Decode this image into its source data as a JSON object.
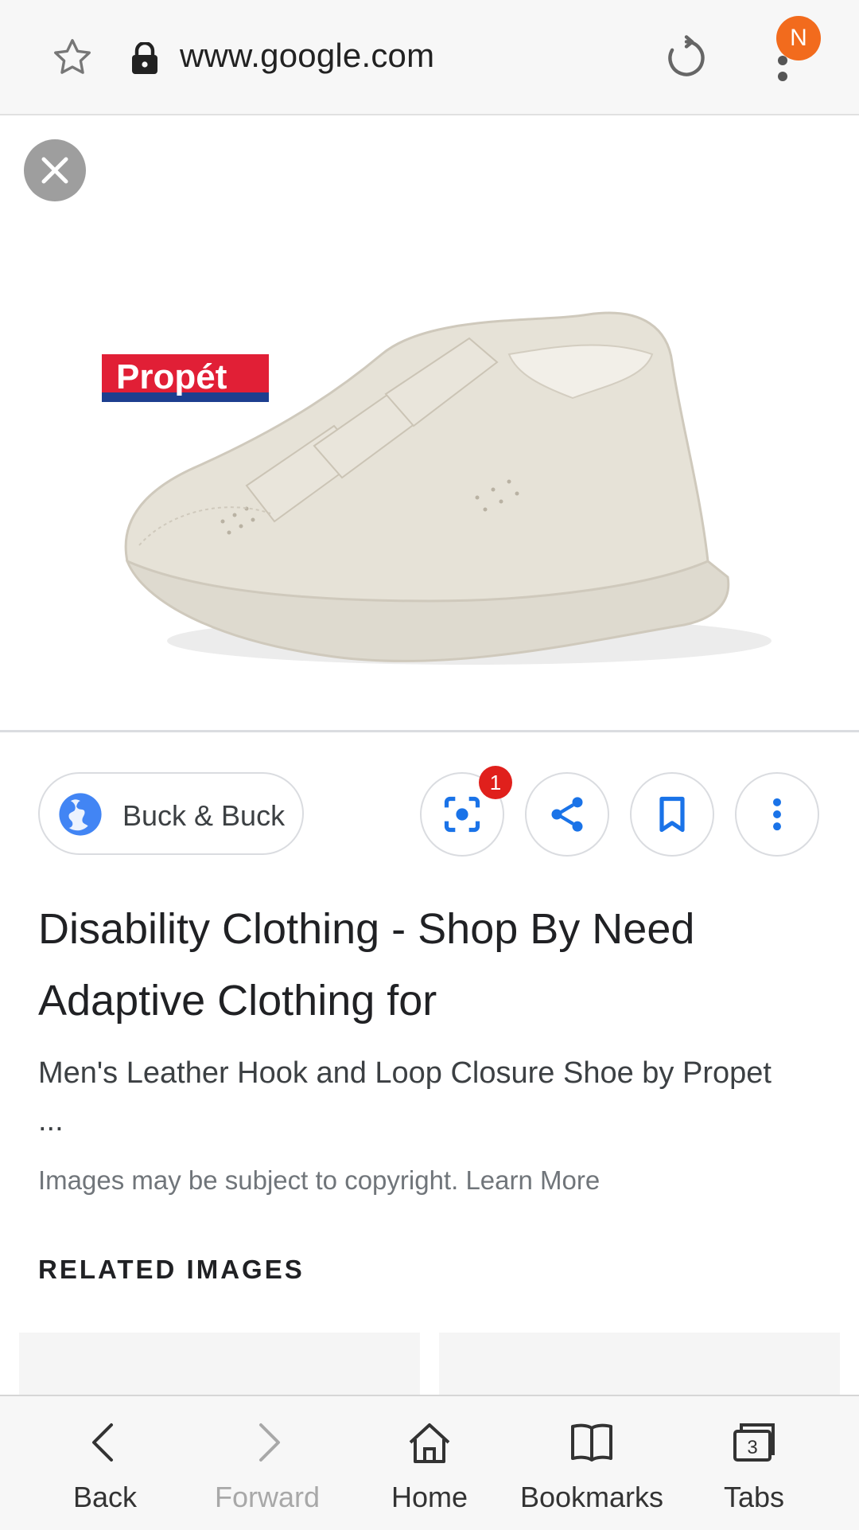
{
  "browser": {
    "url": "www.google.com",
    "profile_initial": "N",
    "accent_color": "#f26b1d"
  },
  "image_viewer": {
    "brand_logo_text": "Propét",
    "image_subject": "beige leather shoe with hook and loop straps"
  },
  "result": {
    "source_name": "Buck & Buck",
    "lens_badge_count": "1",
    "title": "Disability Clothing - Shop By Need Adaptive Clothing for",
    "snippet": "Men's Leather Hook and Loop Closure Shoe by Propet ...",
    "copyright_text": "Images may be subject to copyright.",
    "learn_more_label": "Learn More",
    "related_heading": "RELATED IMAGES"
  },
  "toolbar": {
    "back_label": "Back",
    "forward_label": "Forward",
    "home_label": "Home",
    "bookmarks_label": "Bookmarks",
    "tabs_label": "Tabs",
    "tabs_count": "3"
  },
  "icons": [
    "star-icon",
    "lock-icon",
    "reload-icon",
    "more-vert-icon",
    "close-icon",
    "globe-icon",
    "lens-icon",
    "share-icon",
    "bookmark-icon",
    "more-options-icon",
    "back-icon",
    "forward-icon",
    "home-icon",
    "bookmarks-icon",
    "tabs-icon"
  ]
}
